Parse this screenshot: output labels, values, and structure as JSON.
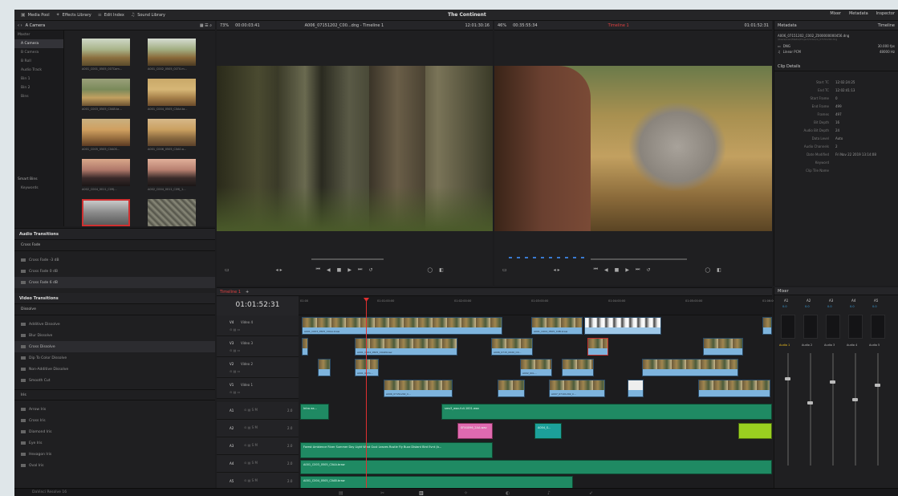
{
  "topbar": {
    "items": [
      "Media Pool",
      "Effects Library",
      "Edit Index",
      "Sound Library"
    ],
    "project_title": "The Continent",
    "right_tabs": [
      "Mixer",
      "Metadata",
      "Inspector"
    ]
  },
  "media_pool": {
    "bin_label": "A Camera",
    "master": "Master",
    "bins": [
      "A Camera",
      "B Camera",
      "B Roll",
      "Audio Track",
      "Bin 1",
      "Bin 2",
      "Bins"
    ],
    "smart_bins": "Smart Bins",
    "smart_item": "Keywords",
    "clips": [
      "A001_C001_0505_01TCam...",
      "A001_C002_0505_01T0.m...",
      "A001_C003_0505_C0AB.ta...",
      "A001_C004_0505_C0Ad.ta...",
      "A001_C005_0505_C0A0S...",
      "A001_C006_0505_C0A0.a...",
      "A002_C004_0011_C09J...",
      "A002_C004_0011_C09J_1..."
    ]
  },
  "effects": {
    "audio_transitions": "Audio Transitions",
    "cross_fade": "Cross Fade",
    "audio_items": [
      "Cross Fade -3 dB",
      "Cross Fade 0 dB",
      "Cross Fade 6 dB"
    ],
    "video_transitions": "Video Transitions",
    "dissolve": "Dissolve",
    "video_items": [
      "Additive Dissolve",
      "Blur Dissolve",
      "Cross Dissolve",
      "Dip To Color Dissolve",
      "Non-Additive Dissolve",
      "Smooth Cut"
    ],
    "iris": "Iris",
    "iris_items": [
      "Arrow Iris",
      "Cross Iris",
      "Diamond Iris",
      "Eye Iris",
      "Hexagon Iris",
      "Oval Iris"
    ]
  },
  "source_viewer": {
    "zoom": "73%",
    "timecode_left": "00:00:03:41",
    "clip_name": "A006_07151202_C00...dng - Timeline 1",
    "timecode_right": "12:01:30:16"
  },
  "timeline_viewer": {
    "zoom": "46%",
    "timecode_left": "00:35:55:34",
    "timeline_name": "Timeline 1",
    "timecode_right": "01:01:52:31"
  },
  "metadata": {
    "title": "Metadata",
    "timeline_tab": "Timeline",
    "file_name": "A006_07151202_C002_Z000000000456.dng",
    "file_path": "/Users/user/Media/Project/Video/A_07151202.dng",
    "res": "DNG",
    "fps": "30.000 fps",
    "audio": "Linear PCM",
    "hz": "48000 Hz",
    "clip_details": "Clip Details",
    "fields": [
      [
        "Start TC",
        "12:02:24:25"
      ],
      [
        "End TC",
        "12:02:41:13"
      ],
      [
        "Start Frame",
        "0"
      ],
      [
        "End Frame",
        "499"
      ],
      [
        "Frames",
        "497"
      ],
      [
        "Bit Depth",
        "16"
      ],
      [
        "Audio Bit Depth",
        "24"
      ],
      [
        "Data Level",
        "Auto"
      ],
      [
        "Audio Channels",
        "2"
      ],
      [
        "Date Modified",
        "Fri Nov 22 2019 13:14:08"
      ],
      [
        "Keyword",
        ""
      ],
      [
        "Clip Tile Name",
        ""
      ]
    ]
  },
  "timeline": {
    "tab": "Timeline 1",
    "timecode": "01:01:52:31",
    "ruler": [
      "01:00",
      "01:01:00:00",
      "01:02:00:00",
      "01:03:00:00",
      "01:04:00:00",
      "01:05:00:00",
      "01:06:00:00"
    ],
    "video_tracks": [
      {
        "id": "V4",
        "name": "Video 4"
      },
      {
        "id": "V3",
        "name": "Video 3"
      },
      {
        "id": "V2",
        "name": "Video 2"
      },
      {
        "id": "V1",
        "name": "Video 1"
      }
    ],
    "audio_tracks": [
      "A1",
      "A2",
      "A3",
      "A4",
      "A5"
    ],
    "audio_levels": [
      "2.0",
      "2.0",
      "2.0",
      "2.0",
      "2.0"
    ],
    "clips": {
      "v4a": "A001_C003_0505_C0AA.braw",
      "v4b": "A001_C004_0505_C0B.braw",
      "v3a": "A001_C004_0505_C0AP.braw",
      "v3b": "A006_0715_0020_C0...",
      "v2a": "A001_0071...",
      "v2b": "A002_0CL...",
      "v1a": "A006_07151202_C...",
      "v1b": "A007_07101202_C...",
      "a1": "Intro ea...",
      "a1b": "sms3_wav-full-1001.wav",
      "a2": "SFX4096_2AA.wav",
      "a2b": "A004_S...",
      "a3": "Forest Ambience River Summer Day Light Wind Gust Leaves Rustle Fly Buzz Distant Bird Evnt (b...",
      "a4": "A001_C004...",
      "a4b": "A001_C003_0505_C0AA.braw",
      "a5": "A001_C004_0505_C0AB.braw"
    }
  },
  "mixer": {
    "title": "Mixer",
    "channels": [
      "A1",
      "A2",
      "A3",
      "A4",
      "A5"
    ],
    "buses": [
      "Audio 1",
      "Audio 2",
      "Audio 3",
      "Audio 4",
      "Audio 5"
    ],
    "level": "0.0"
  },
  "bottombar": {
    "app_name": "DaVinci Resolve 16"
  }
}
